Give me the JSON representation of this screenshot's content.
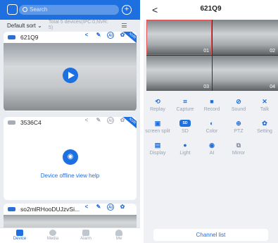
{
  "left": {
    "search_placeholder": "Search",
    "sort_label": "Default sort ⌄",
    "device_count": "Total 5 devices(IPC:0,NVR: 5)",
    "devices": [
      {
        "name": "621Q9",
        "ribbon": "NVR"
      },
      {
        "name": "3536C4",
        "ribbon": "NVR",
        "offline_text": "Device offline view help"
      },
      {
        "name": "so2mlRHooDUJzvSi...",
        "ribbon": ""
      }
    ],
    "tabs": [
      {
        "label": "Device",
        "active": true
      },
      {
        "label": "Media",
        "active": false
      },
      {
        "label": "Alarm",
        "active": false
      },
      {
        "label": "Me",
        "active": false
      }
    ]
  },
  "right": {
    "title": "621Q9",
    "channels": [
      "01",
      "02",
      "03",
      "04"
    ],
    "controls_row1": [
      "Replay",
      "Capture",
      "Record",
      "Sound",
      "Talk"
    ],
    "controls_row2": [
      "screen split",
      "SD",
      "Color",
      "PTZ",
      "Setting"
    ],
    "controls_row3": [
      "Display",
      "Light",
      "AI",
      "Mirror"
    ],
    "sd_badge": "SD",
    "channel_list": "Channel list"
  },
  "colors": {
    "accent": "#1e6fe0"
  }
}
